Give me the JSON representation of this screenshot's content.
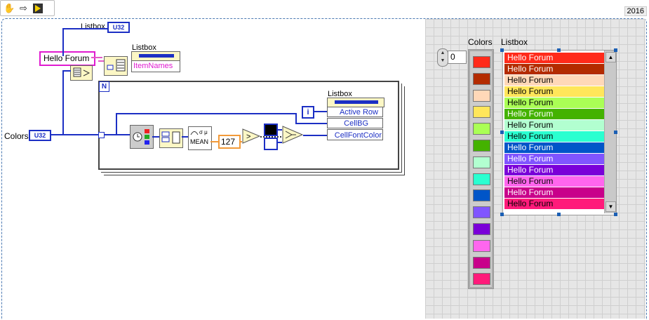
{
  "version": "2016",
  "toolbar": {
    "icons": [
      "hand-icon",
      "arrow-right-icon",
      "run-icon"
    ]
  },
  "diagram": {
    "listbox_label_top": "Listbox",
    "u32_label": "U32",
    "hello_forum_const": "Hello Forum",
    "listbox_node_label": "Listbox",
    "item_names_prop": "ItemNames",
    "colors_label": "Colors",
    "loop_count_label": "N",
    "iteration_label": "i",
    "listbox_prop_label": "Listbox",
    "active_row_prop": "Active Row",
    "cellbg_prop": "CellBG",
    "cellfontcolor_prop": "CellFontColor",
    "mean_label": "MEAN",
    "const_127": "127",
    "greater_symbol": ">"
  },
  "front_panel": {
    "index_value": "0",
    "colors_label": "Colors",
    "listbox_label": "Listbox",
    "colors": [
      "#ff2a1a",
      "#b32b00",
      "#ffd8b8",
      "#ffe65a",
      "#aaff55",
      "#44b200",
      "#b2ffd0",
      "#2affd0",
      "#0055c8",
      "#8055ff",
      "#7a00d8",
      "#ff66ee",
      "#c8008a",
      "#ff1a7a"
    ],
    "items": [
      {
        "label": "Hello Forum",
        "bg": "#ff2a1a",
        "fg": "#ffffff"
      },
      {
        "label": "Hello Forum",
        "bg": "#b32b00",
        "fg": "#ffffff"
      },
      {
        "label": "Hello Forum",
        "bg": "#ffd8b8",
        "fg": "#000000"
      },
      {
        "label": "Hello Forum",
        "bg": "#ffe65a",
        "fg": "#000000"
      },
      {
        "label": "Hello Forum",
        "bg": "#aaff55",
        "fg": "#000000"
      },
      {
        "label": "Hello Forum",
        "bg": "#44b200",
        "fg": "#ffffff"
      },
      {
        "label": "Hello Forum",
        "bg": "#b2ffd0",
        "fg": "#000000"
      },
      {
        "label": "Hello Forum",
        "bg": "#2affd0",
        "fg": "#000000"
      },
      {
        "label": "Hello Forum",
        "bg": "#0055c8",
        "fg": "#ffffff"
      },
      {
        "label": "Hello Forum",
        "bg": "#8055ff",
        "fg": "#ffffff"
      },
      {
        "label": "Hello Forum",
        "bg": "#7a00d8",
        "fg": "#ffffff"
      },
      {
        "label": "Hello Forum",
        "bg": "#ff66ee",
        "fg": "#000000"
      },
      {
        "label": "Hello Forum",
        "bg": "#c8008a",
        "fg": "#ffffff"
      },
      {
        "label": "Hello Forum",
        "bg": "#ff1a7a",
        "fg": "#000000"
      }
    ]
  }
}
